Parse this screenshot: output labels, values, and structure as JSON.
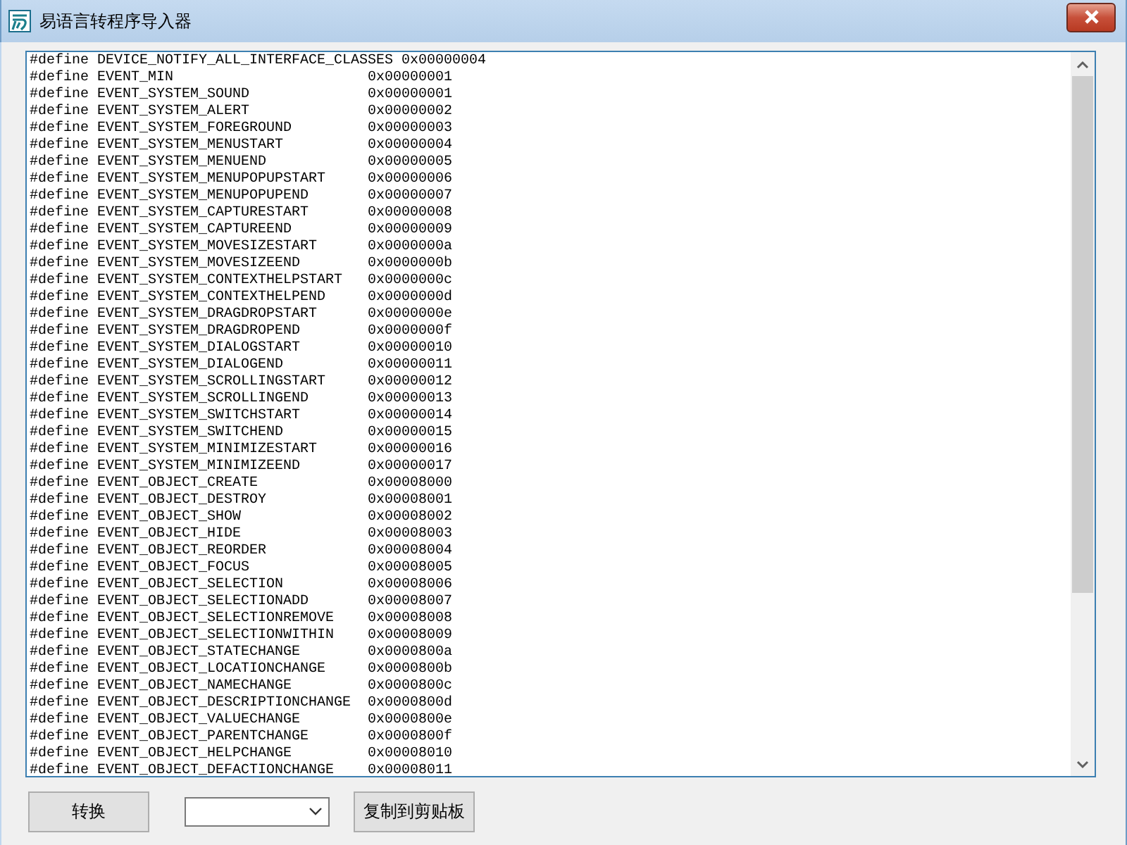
{
  "window": {
    "title": "易语言转程序导入器"
  },
  "editor": {
    "lines": [
      "#define DEVICE_NOTIFY_ALL_INTERFACE_CLASSES 0x00000004",
      "#define EVENT_MIN                       0x00000001",
      "#define EVENT_SYSTEM_SOUND              0x00000001",
      "#define EVENT_SYSTEM_ALERT              0x00000002",
      "#define EVENT_SYSTEM_FOREGROUND         0x00000003",
      "#define EVENT_SYSTEM_MENUSTART          0x00000004",
      "#define EVENT_SYSTEM_MENUEND            0x00000005",
      "#define EVENT_SYSTEM_MENUPOPUPSTART     0x00000006",
      "#define EVENT_SYSTEM_MENUPOPUPEND       0x00000007",
      "#define EVENT_SYSTEM_CAPTURESTART       0x00000008",
      "#define EVENT_SYSTEM_CAPTUREEND         0x00000009",
      "#define EVENT_SYSTEM_MOVESIZESTART      0x0000000a",
      "#define EVENT_SYSTEM_MOVESIZEEND        0x0000000b",
      "#define EVENT_SYSTEM_CONTEXTHELPSTART   0x0000000c",
      "#define EVENT_SYSTEM_CONTEXTHELPEND     0x0000000d",
      "#define EVENT_SYSTEM_DRAGDROPSTART      0x0000000e",
      "#define EVENT_SYSTEM_DRAGDROPEND        0x0000000f",
      "#define EVENT_SYSTEM_DIALOGSTART        0x00000010",
      "#define EVENT_SYSTEM_DIALOGEND          0x00000011",
      "#define EVENT_SYSTEM_SCROLLINGSTART     0x00000012",
      "#define EVENT_SYSTEM_SCROLLINGEND       0x00000013",
      "#define EVENT_SYSTEM_SWITCHSTART        0x00000014",
      "#define EVENT_SYSTEM_SWITCHEND          0x00000015",
      "#define EVENT_SYSTEM_MINIMIZESTART      0x00000016",
      "#define EVENT_SYSTEM_MINIMIZEEND        0x00000017",
      "#define EVENT_OBJECT_CREATE             0x00008000",
      "#define EVENT_OBJECT_DESTROY            0x00008001",
      "#define EVENT_OBJECT_SHOW               0x00008002",
      "#define EVENT_OBJECT_HIDE               0x00008003",
      "#define EVENT_OBJECT_REORDER            0x00008004",
      "#define EVENT_OBJECT_FOCUS              0x00008005",
      "#define EVENT_OBJECT_SELECTION          0x00008006",
      "#define EVENT_OBJECT_SELECTIONADD       0x00008007",
      "#define EVENT_OBJECT_SELECTIONREMOVE    0x00008008",
      "#define EVENT_OBJECT_SELECTIONWITHIN    0x00008009",
      "#define EVENT_OBJECT_STATECHANGE        0x0000800a",
      "#define EVENT_OBJECT_LOCATIONCHANGE     0x0000800b",
      "#define EVENT_OBJECT_NAMECHANGE         0x0000800c",
      "#define EVENT_OBJECT_DESCRIPTIONCHANGE  0x0000800d",
      "#define EVENT_OBJECT_VALUECHANGE        0x0000800e",
      "#define EVENT_OBJECT_PARENTCHANGE       0x0000800f",
      "#define EVENT_OBJECT_HELPCHANGE         0x00008010",
      "#define EVENT_OBJECT_DEFACTIONCHANGE    0x00008011"
    ]
  },
  "toolbar": {
    "convert_button": "转换",
    "copy_button": "复制到剪贴板"
  }
}
